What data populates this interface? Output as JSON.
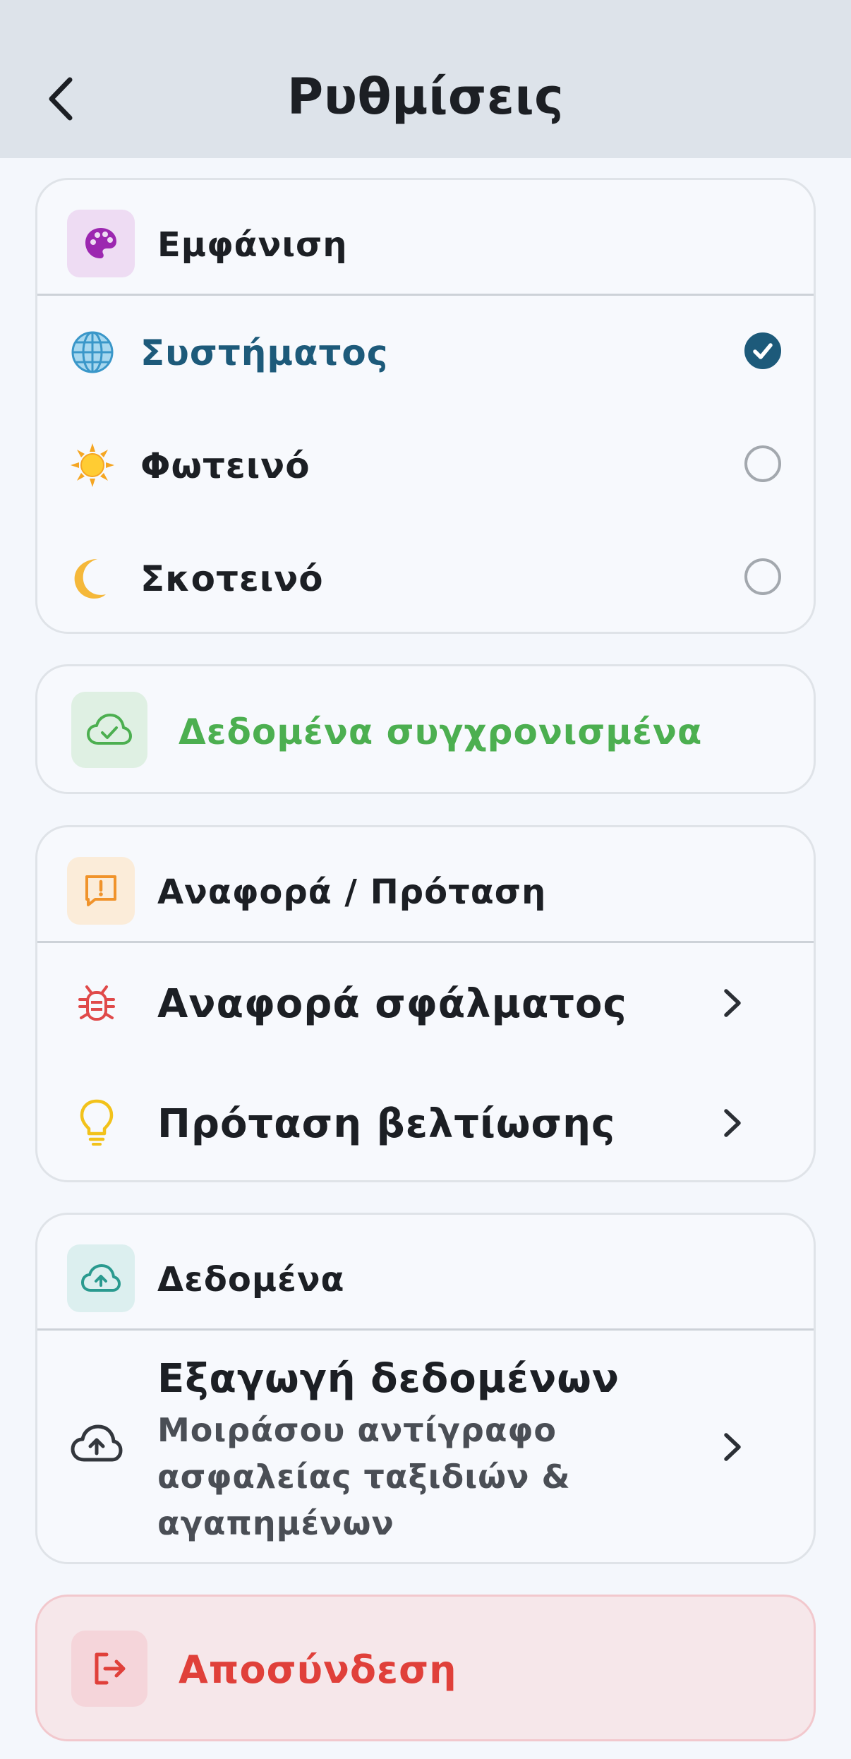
{
  "header": {
    "title": "Ρυθμίσεις",
    "back_icon": "chevron-left-icon"
  },
  "appearance": {
    "title": "Εμφάνιση",
    "icon": "palette-icon",
    "options": [
      {
        "label": "Συστήματος",
        "icon": "globe-icon",
        "selected": true
      },
      {
        "label": "Φωτεινό",
        "icon": "sun-icon",
        "selected": false
      },
      {
        "label": "Σκοτεινό",
        "icon": "moon-icon",
        "selected": false
      }
    ]
  },
  "sync": {
    "label": "Δεδομένα συγχρονισμένα",
    "icon": "cloud-check-icon",
    "color": "#4caf50"
  },
  "feedback": {
    "title": "Αναφορά / Πρόταση",
    "icon": "message-alert-icon",
    "items": [
      {
        "label": "Αναφορά σφάλματος",
        "icon": "bug-icon"
      },
      {
        "label": "Πρόταση βελτίωσης",
        "icon": "lightbulb-icon"
      }
    ]
  },
  "data": {
    "title": "Δεδομένα",
    "icon": "cloud-upload-icon",
    "export": {
      "title": "Εξαγωγή δεδομένων",
      "description_lines": [
        "Μοιράσου αντίγραφο",
        "ασφαλείας ταξιδιών &",
        "αγαπημένων"
      ],
      "icon": "cloud-upload-icon"
    }
  },
  "logout": {
    "label": "Αποσύνδεση",
    "icon": "logout-icon",
    "color": "#e0403a"
  },
  "colors": {
    "accent": "#1d5a7a",
    "header_bg": "#dde3ea",
    "page_bg": "#f4f7fc",
    "palette_bg": "#eedcf3",
    "feedback_bg": "#fbecd9",
    "data_bg": "#dcefef",
    "logout_bg": "#f6e7ea"
  }
}
